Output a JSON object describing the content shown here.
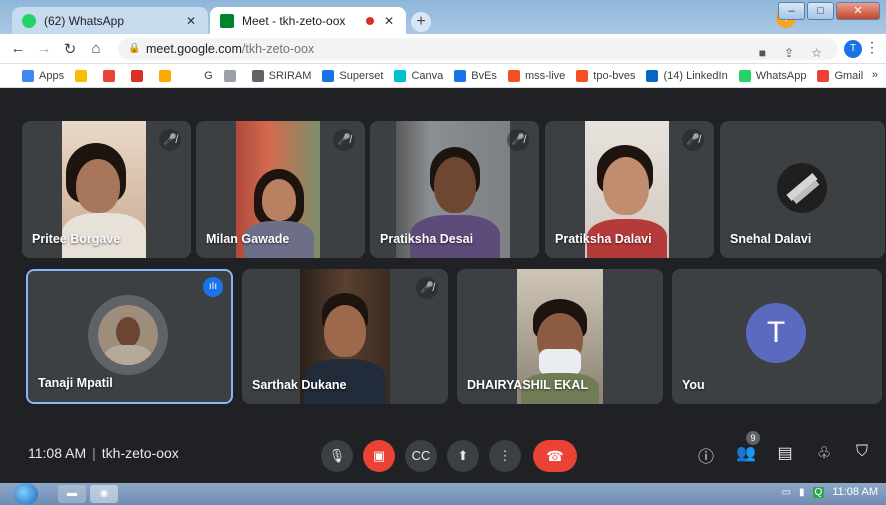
{
  "browser": {
    "tabs": [
      {
        "title": "(62) WhatsApp",
        "favicon": "whatsapp-icon",
        "color": "#25d366"
      },
      {
        "title": "Meet - tkh-zeto-oox",
        "favicon": "meet-icon",
        "color": "#00832d"
      }
    ],
    "address": {
      "host": "meet.google.com",
      "path": "/tkh-zeto-oox"
    },
    "profile_initial": "T",
    "bookmarks": [
      {
        "label": "Apps",
        "color": "#4285f4"
      },
      {
        "label": "",
        "color": "#fbbc05"
      },
      {
        "label": "",
        "color": "#ea4335"
      },
      {
        "label": "",
        "color": "#d93025"
      },
      {
        "label": "",
        "color": "#f9ab00"
      },
      {
        "label": "G",
        "color": "#ffffff"
      },
      {
        "label": "",
        "color": "#9aa0a6"
      },
      {
        "label": "SRIRAM",
        "color": "#5f6368"
      },
      {
        "label": "Superset",
        "color": "#1a73e8"
      },
      {
        "label": "Canva",
        "color": "#00c4cc"
      },
      {
        "label": "BvEs",
        "color": "#1a73e8"
      },
      {
        "label": "mss-live",
        "color": "#f25022"
      },
      {
        "label": "tpo-bves",
        "color": "#f25022"
      },
      {
        "label": "(14) LinkedIn",
        "color": "#0a66c2"
      },
      {
        "label": "WhatsApp",
        "color": "#25d366"
      },
      {
        "label": "Gmail",
        "color": "#ea4335"
      }
    ],
    "bookmarks_more": "»"
  },
  "meet": {
    "participants": [
      {
        "name": "Pritee Borgave",
        "muted": true
      },
      {
        "name": "Milan Gawade",
        "muted": true
      },
      {
        "name": "Pratiksha Desai",
        "muted": true
      },
      {
        "name": "Pratiksha Dalavi",
        "muted": true
      },
      {
        "name": "Snehal Dalavi",
        "muted": false
      },
      {
        "name": "Tanaji Mpatil",
        "muted": false,
        "speaking": true
      },
      {
        "name": "Sarthak Dukane",
        "muted": true
      },
      {
        "name": "DHAIRYASHIL EKAL",
        "muted": false
      },
      {
        "name": "You",
        "muted": false,
        "avatar_initial": "T"
      }
    ],
    "time": "11:08 AM",
    "meeting_code": "tkh-zeto-oox",
    "participant_count": "9"
  },
  "taskbar": {
    "clock": "11:08 AM"
  },
  "colors": {
    "meet_bg": "#202124",
    "tile_bg": "#3c4043",
    "accent": "#1a73e8",
    "danger": "#ea4335",
    "you_avatar": "#5b6abf"
  }
}
